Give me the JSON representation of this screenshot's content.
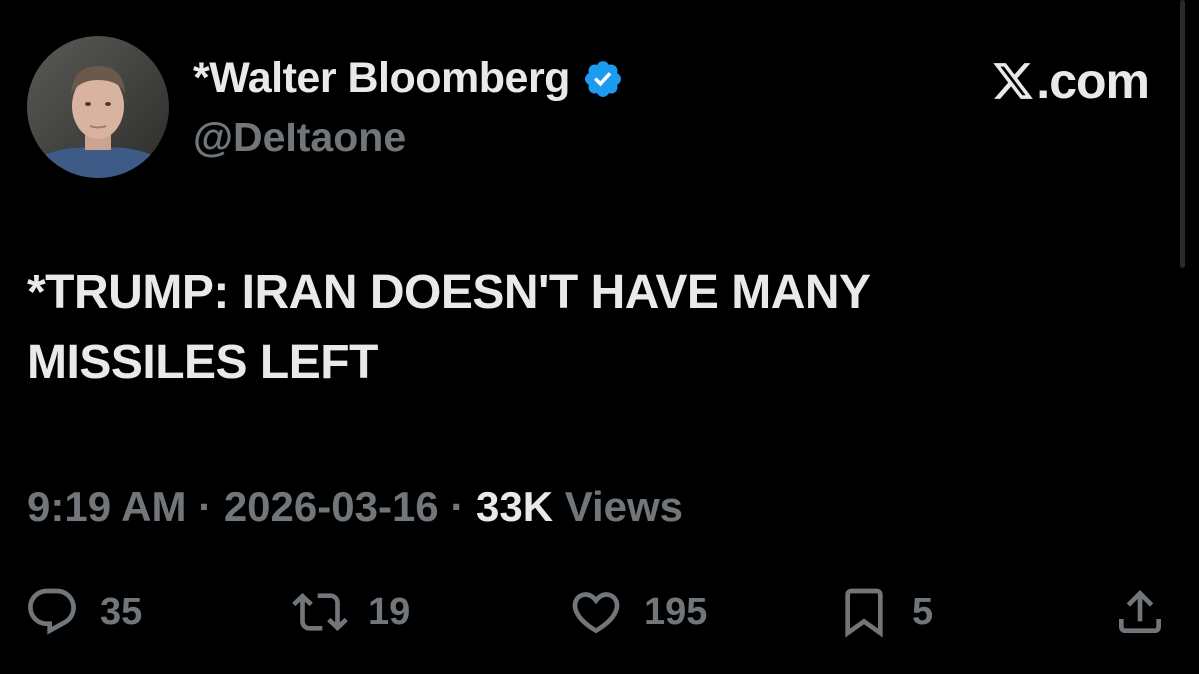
{
  "author": {
    "display_name": "*Walter Bloomberg",
    "handle": "@DeItaone",
    "verified": true
  },
  "source": {
    "site": ".com",
    "logo": "x-logo-icon"
  },
  "tweet": {
    "line1": "*TRUMP: IRAN DOESN'T HAVE MANY",
    "line2": "MISSILES LEFT"
  },
  "meta": {
    "time": "9:19 AM",
    "separator": " · ",
    "date": "2026-03-16",
    "views_count": "33K",
    "views_label": " Views"
  },
  "actions": {
    "replies": "35",
    "reposts": "19",
    "likes": "195",
    "bookmarks": "5"
  },
  "icons": {
    "reply": "reply-icon",
    "repost": "repost-icon",
    "like": "heart-icon",
    "bookmark": "bookmark-icon",
    "share": "share-icon",
    "verified": "verified-badge-icon"
  },
  "colors": {
    "background": "#000000",
    "text": "#e7e9ea",
    "muted": "#71767b",
    "verified": "#1d9bf0"
  }
}
